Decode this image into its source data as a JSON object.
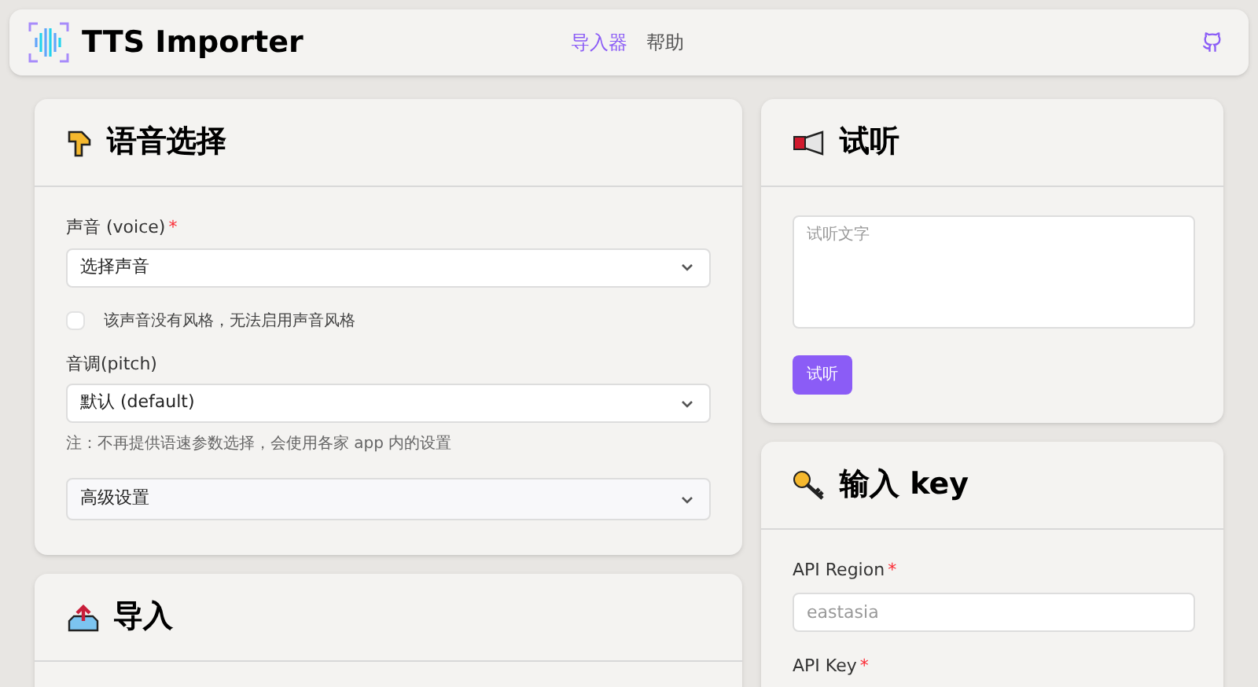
{
  "header": {
    "title": "TTS Importer",
    "nav": [
      {
        "label": "导入器",
        "selected": true
      },
      {
        "label": "帮助",
        "selected": false
      }
    ]
  },
  "voice_card": {
    "title": "语音选择",
    "fields": [
      {
        "label": "声音 (voice)",
        "required_mark": "*",
        "value": "选择声音"
      }
    ],
    "style_checkbox": {
      "label": "该声音没有风格，无法启用声音风格",
      "checked": false
    },
    "pitch": {
      "label": "音调(pitch)",
      "value": "默认 (default)"
    },
    "note": "注：不再提供语速参数选择，会使用各家 app 内的设置",
    "advanced": {
      "label": "高级设置",
      "expanded": false
    }
  },
  "import_card": {
    "title": "导入"
  },
  "preview_card": {
    "title": "试听",
    "textarea": {
      "placeholder": "试听文字"
    },
    "button": "试听"
  },
  "key_card": {
    "title": "输入 key",
    "fields": [
      {
        "label": "API Region",
        "required_mark": "*",
        "placeholder": "eastasia"
      },
      {
        "label": "API Key",
        "required_mark": "*"
      }
    ]
  }
}
